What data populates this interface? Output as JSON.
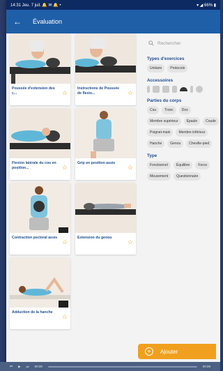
{
  "status": {
    "left": "14:31 Jeu. 7 juil. 🔔 ✉ 🔔 •",
    "right": "▾ ◢ 66% ▮"
  },
  "appbar": {
    "back": "←",
    "title": "Évaluation"
  },
  "cards": [
    {
      "caption": "Poussée d'extension des c...",
      "star": "☆"
    },
    {
      "caption": "Instructions de Poussée de flexio...",
      "star": "☆"
    },
    {
      "caption": "Flexion latérale du cou en position...",
      "star": "☆"
    },
    {
      "caption": "Grip en position assis",
      "star": "☆"
    },
    {
      "caption": "Contraction pectoral assis",
      "star": "☆"
    },
    {
      "caption": "Extension du genou",
      "star": "☆"
    },
    {
      "caption": "Adduction de la hanche",
      "star": "☆"
    }
  ],
  "search": {
    "icon": "search-icon",
    "placeholder": "Rechercher"
  },
  "filters": {
    "types": {
      "title": "Types d'exercices",
      "chips": [
        "Unitaire",
        "Protocole"
      ]
    },
    "accessories": {
      "title": "Accessoires"
    },
    "body": {
      "title": "Parties du corps",
      "chips": [
        "Cou",
        "Tronc",
        "Dos",
        "Membre supérieur",
        "Epaule",
        "Coude",
        "Poignet-main",
        "Membre inférieur",
        "Hanche",
        "Genou",
        "Cheville-pied"
      ]
    },
    "type": {
      "title": "Type",
      "chips": [
        "Fonctionnel",
        "Équilibre",
        "Force",
        "Mouvement",
        "Questionnaire"
      ]
    }
  },
  "add_button": {
    "label": "Ajouter"
  },
  "video": {
    "time_left": "00:00",
    "time_right": "00:09"
  },
  "colors": {
    "primary": "#1f5fa8",
    "accent": "#f0a01e",
    "title": "#1f4e8e"
  }
}
